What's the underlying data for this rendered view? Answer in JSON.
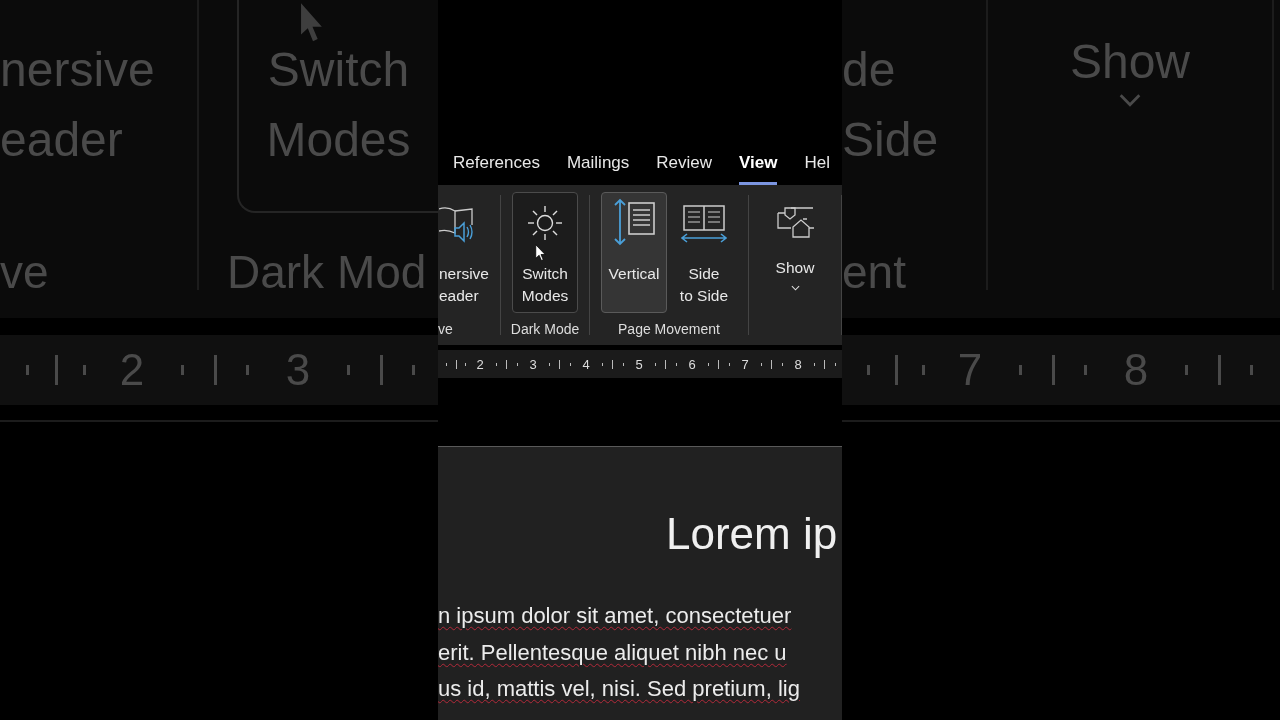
{
  "backdrop_left": {
    "ribbon_button_1": {
      "lines": [
        "nersive",
        "eader"
      ]
    },
    "group_1": "ve",
    "ribbon_button_2": {
      "lines": [
        "Switch",
        "Modes"
      ],
      "hovered": true
    },
    "group_2": "Dark Mod",
    "ruler": [
      "2",
      "3"
    ]
  },
  "backdrop_right": {
    "ribbon_button_1": {
      "lines": [
        "de",
        "Side"
      ]
    },
    "group_1": "ent",
    "ribbon_button_2": {
      "lines": [
        "Show"
      ],
      "dropdown": true
    },
    "ruler": [
      "7",
      "8"
    ]
  },
  "tabs": [
    {
      "label": "References",
      "selected": false
    },
    {
      "label": "Mailings",
      "selected": false
    },
    {
      "label": "Review",
      "selected": false
    },
    {
      "label": "View",
      "selected": true
    },
    {
      "label": "Hel",
      "selected": false
    }
  ],
  "ribbon_groups": [
    {
      "label": "ve",
      "buttons": [
        {
          "kind": "reader",
          "lines": [
            "nersive",
            "eader"
          ],
          "selected": false,
          "hovered": false
        }
      ]
    },
    {
      "label": "Dark Mode",
      "buttons": [
        {
          "kind": "sun",
          "lines": [
            "Switch",
            "Modes"
          ],
          "selected": false,
          "hovered": true
        }
      ]
    },
    {
      "label": "Page Movement",
      "buttons": [
        {
          "kind": "vertical",
          "lines": [
            "Vertical"
          ],
          "selected": true,
          "hovered": false
        },
        {
          "kind": "side",
          "lines": [
            "Side",
            "to Side"
          ],
          "selected": false,
          "hovered": false
        }
      ]
    },
    {
      "buttons": [
        {
          "kind": "show",
          "lines": [
            "Show"
          ],
          "selected": false,
          "hovered": false,
          "dropdown": true
        }
      ]
    }
  ],
  "ruler": [
    "2",
    "3",
    "4",
    "5",
    "6",
    "7",
    "8"
  ],
  "document": {
    "title": "Lorem ip",
    "lines": [
      "n ipsum dolor sit amet, consectetuer",
      "erit. Pellentesque aliquet nibh nec u",
      "us id, mattis vel, nisi. Sed pretium, lig"
    ]
  }
}
